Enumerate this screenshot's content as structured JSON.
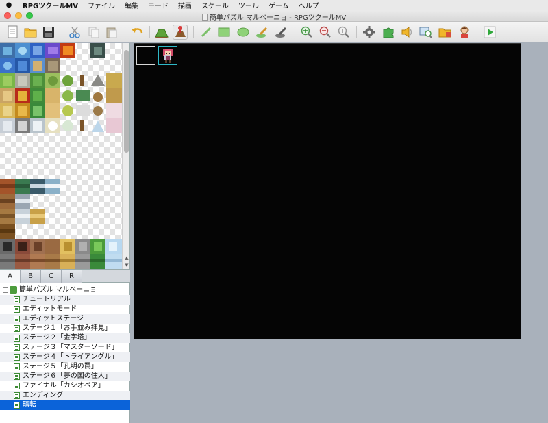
{
  "menubar": {
    "app_name": "RPGツクールMV",
    "items": [
      "ファイル",
      "編集",
      "モード",
      "描画",
      "スケール",
      "ツール",
      "ゲーム",
      "ヘルプ"
    ]
  },
  "window": {
    "title": "簡単パズル マルベーニョ - RPGツクールMV"
  },
  "toolbar": {
    "icons": [
      "new-project-icon",
      "open-project-icon",
      "save-project-icon",
      "cut-icon",
      "copy-icon",
      "paste-icon",
      "undo-icon",
      "map-mode-icon",
      "event-mode-icon",
      "pencil-icon",
      "rectangle-icon",
      "ellipse-icon",
      "flood-fill-icon",
      "shadow-pen-icon",
      "zoom-in-icon",
      "zoom-out-icon",
      "zoom-actual-icon",
      "database-icon",
      "plugin-manager-icon",
      "sound-test-icon",
      "event-searcher-icon",
      "resource-manager-icon",
      "character-generator-icon",
      "playtest-icon"
    ]
  },
  "tileset_tabs": [
    "A",
    "B",
    "C",
    "R"
  ],
  "active_tab": "A",
  "map_tree": {
    "root": "簡単パズル マルベーニョ",
    "maps": [
      "チュートリアル",
      "エディットモード",
      "エディットステージ",
      "ステージ１「お手並み拝見」",
      "ステージ２「金字塔」",
      "ステージ３「マスターソード」",
      "ステージ４「トライアングル」",
      "ステージ５「孔明の罠」",
      "ステージ６「夢の国の住人」",
      "ファイナル「カシオペア」",
      "エンディング",
      "暗転"
    ],
    "selected": "暗転"
  },
  "colors": {
    "selection": "#0b63d9",
    "map_background": "#050505",
    "hero_event_border": "#2fb8c7"
  }
}
